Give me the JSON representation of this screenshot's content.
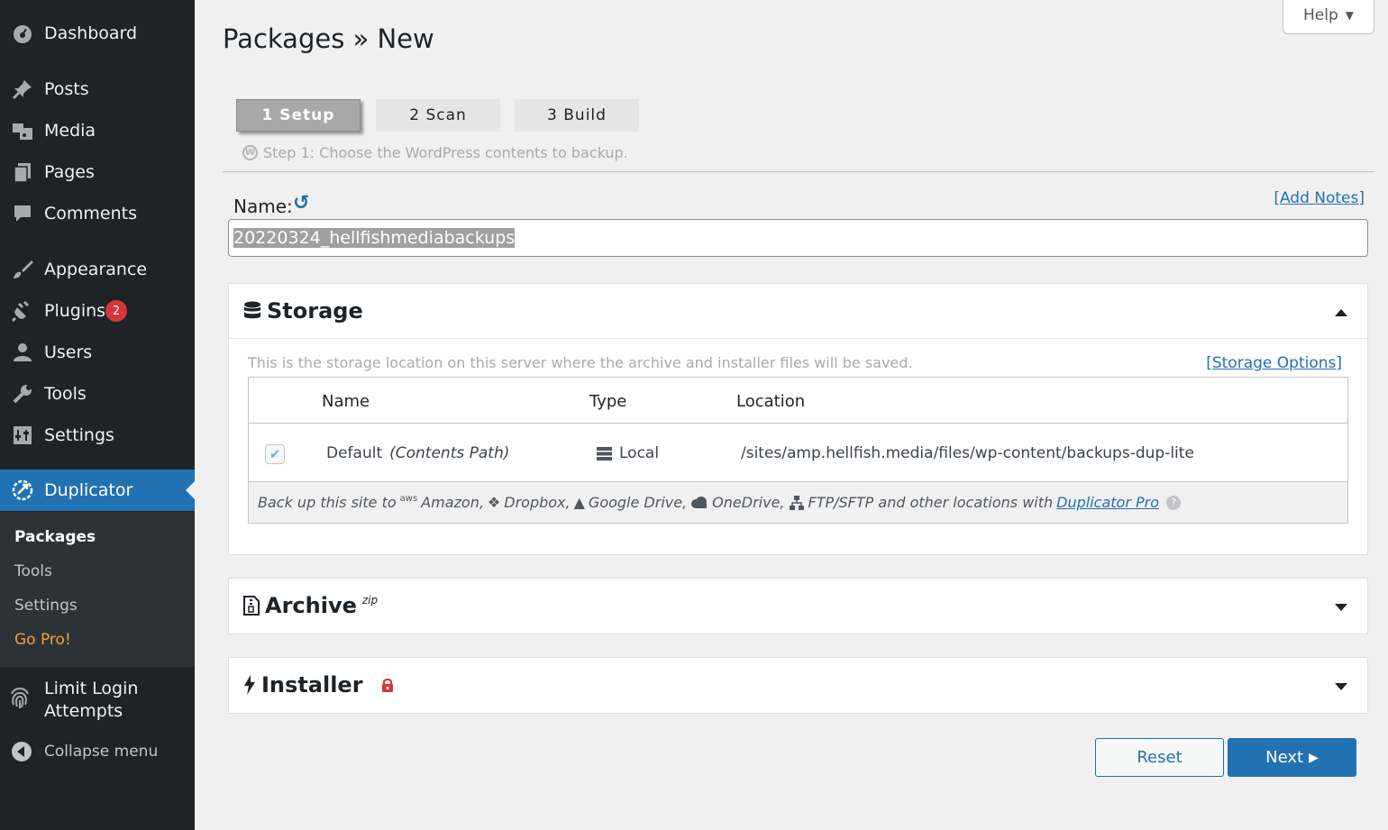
{
  "sidebar": {
    "menu": [
      {
        "label": "Dashboard",
        "icon": "dashboard-icon"
      },
      {
        "label": "Posts",
        "icon": "pushpin-icon"
      },
      {
        "label": "Media",
        "icon": "media-icon"
      },
      {
        "label": "Pages",
        "icon": "pages-icon"
      },
      {
        "label": "Comments",
        "icon": "comment-icon"
      },
      {
        "label": "Appearance",
        "icon": "paintbrush-icon"
      },
      {
        "label": "Plugins",
        "icon": "plug-icon",
        "badge": "2"
      },
      {
        "label": "Users",
        "icon": "user-icon"
      },
      {
        "label": "Tools",
        "icon": "wrench-icon"
      },
      {
        "label": "Settings",
        "icon": "settings-icon"
      },
      {
        "label": "Duplicator",
        "icon": "duplicator-icon",
        "active": true
      }
    ],
    "submenu": [
      {
        "label": "Packages",
        "current": true
      },
      {
        "label": "Tools"
      },
      {
        "label": "Settings"
      },
      {
        "label": "Go Pro!"
      }
    ],
    "limit_login": {
      "line1": "Limit Login",
      "line2": "Attempts"
    },
    "collapse": "Collapse menu"
  },
  "header": {
    "help": "Help",
    "title": "Packages » New"
  },
  "steps": [
    {
      "label": "1 Setup",
      "active": true
    },
    {
      "label": "2 Scan"
    },
    {
      "label": "3 Build"
    }
  ],
  "step_desc": "Step 1: Choose the WordPress contents to backup.",
  "name_field": {
    "label": "Name:",
    "value": "20220324_hellfishmediabackups",
    "add_notes": "[Add Notes]"
  },
  "storage": {
    "title": "Storage",
    "desc": "This is the storage location on this server where the archive and installer files will be saved.",
    "options_link": "[Storage Options]",
    "columns": [
      "Name",
      "Type",
      "Location"
    ],
    "row": {
      "name": "Default",
      "name_note": "(Contents Path)",
      "type": "Local",
      "location": "/sites/amp.hellfish.media/files/wp-content/backups-dup-lite"
    },
    "promo": {
      "prefix": "Back up this site to",
      "aws": "aws",
      "amazon": "Amazon,",
      "dropbox": "Dropbox,",
      "gdrive": "Google Drive,",
      "onedrive": "OneDrive,",
      "ftp": "FTP/SFTP and other locations with",
      "link": "Duplicator Pro"
    }
  },
  "archive": {
    "title": "Archive",
    "sup": "zip"
  },
  "installer": {
    "title": "Installer"
  },
  "buttons": {
    "reset": "Reset",
    "next": "Next"
  },
  "colors": {
    "sidebar": "#1d2327",
    "accent": "#2271b1",
    "badge": "#d63638",
    "gopro": "#f0a13a"
  }
}
